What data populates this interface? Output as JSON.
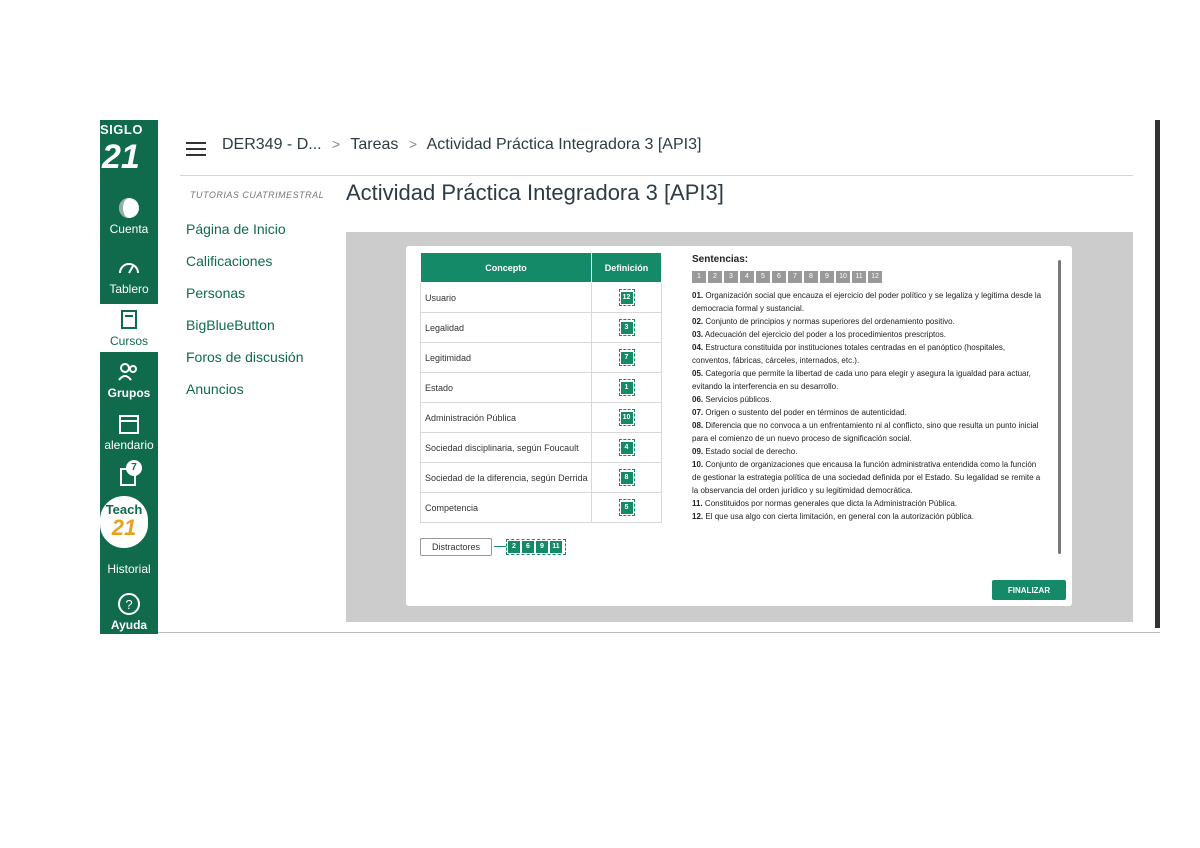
{
  "rail": {
    "logo_top": "SIGLO",
    "logo_num": "21",
    "items": [
      {
        "label": "Cuenta",
        "icon": "account-icon"
      },
      {
        "label": "Tablero",
        "icon": "dashboard-icon"
      },
      {
        "label": "Cursos",
        "icon": "courses-icon"
      },
      {
        "label": "Grupos",
        "icon": "groups-icon"
      },
      {
        "label": "alendario",
        "icon": "calendar-icon"
      },
      {
        "label": "Historial",
        "icon": "history-icon"
      },
      {
        "label": "Ayuda",
        "icon": "help-icon"
      }
    ],
    "inbox_badge": "7",
    "teach_line1": "Teach",
    "teach_line2": "21"
  },
  "header": {
    "crumb_course": "DER349 - D...",
    "crumb_tasks": "Tareas",
    "crumb_current": "Actividad Práctica Integradora 3 [API3]"
  },
  "course_nav": {
    "term": "TUTORIAS CUATRIMESTRAL",
    "links": [
      "Página de Inicio",
      "Calificaciones",
      "Personas",
      "BigBlueButton",
      "Foros de discusión",
      "Anuncios"
    ]
  },
  "page": {
    "title": "Actividad Práctica Integradora 3 [API3]"
  },
  "match_table": {
    "col_concept": "Concepto",
    "col_def": "Definición",
    "rows": [
      {
        "concept": "Usuario",
        "def": "12"
      },
      {
        "concept": "Legalidad",
        "def": "3"
      },
      {
        "concept": "Legitimidad",
        "def": "7"
      },
      {
        "concept": "Estado",
        "def": "1"
      },
      {
        "concept": "Administración Pública",
        "def": "10"
      },
      {
        "concept": "Sociedad disciplinaria, según Foucault",
        "def": "4"
      },
      {
        "concept": "Sociedad de la diferencia, según Derrida",
        "def": "8"
      },
      {
        "concept": "Competencia",
        "def": "5"
      }
    ],
    "distractors_label": "Distractores",
    "distractors": [
      "2",
      "6",
      "9",
      "11"
    ]
  },
  "sentences": {
    "title": "Sentencias:",
    "chips": [
      "1",
      "2",
      "3",
      "4",
      "5",
      "6",
      "7",
      "8",
      "9",
      "10",
      "11",
      "12"
    ],
    "items": [
      {
        "num": "01.",
        "text": "Organización social que encauza el ejercicio del poder político y se legaliza y legitima desde la democracia formal y sustancial."
      },
      {
        "num": "02.",
        "text": "Conjunto de principios y normas superiores del ordenamiento positivo."
      },
      {
        "num": "03.",
        "text": "Adecuación del ejercicio del poder a los procedimientos prescriptos."
      },
      {
        "num": "04.",
        "text": "Estructura constituida por instituciones totales centradas en el panóptico (hospitales, conventos, fábricas, cárceles, internados, etc.)."
      },
      {
        "num": "05.",
        "text": "Categoría que permite la libertad de cada uno para elegir y asegura la igualdad para actuar, evitando la interferencia en su desarrollo."
      },
      {
        "num": "06.",
        "text": "Servicios públicos."
      },
      {
        "num": "07.",
        "text": "Origen o sustento del poder en términos de autenticidad."
      },
      {
        "num": "08.",
        "text": "Diferencia que no convoca a un enfrentamiento ni al conflicto, sino que resulta un punto inicial para el comienzo de un nuevo proceso de significación social."
      },
      {
        "num": "09.",
        "text": "Estado social de derecho."
      },
      {
        "num": "10.",
        "text": "Conjunto de organizaciones que encausa la función administrativa entendida como la función de gestionar la estrategia política de una sociedad definida por el Estado. Su legalidad se remite a la observancia del orden jurídico y su legitimidad democrática."
      },
      {
        "num": "11.",
        "text": "Constituidos por normas generales que dicta la Administración Pública."
      },
      {
        "num": "12.",
        "text": "El que usa algo con cierta limitación, en general con la autorización pública."
      }
    ]
  },
  "finalize_label": "FINALIZAR",
  "colors": {
    "brand": "#0f6b4c",
    "accent": "#148a68"
  }
}
